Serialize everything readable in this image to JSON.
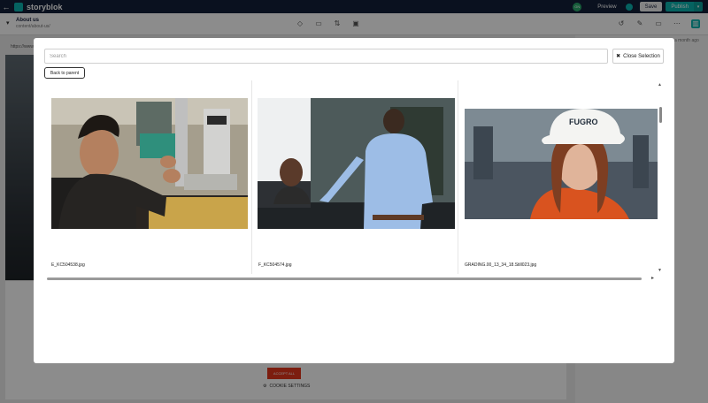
{
  "topbar": {
    "back_glyph": "←",
    "brand": "storyblok",
    "user_initials": "GN",
    "preview_label": "Preview",
    "save_label": "Save",
    "publish_label": "Publish",
    "publish_caret": "▾"
  },
  "subbar": {
    "chevron": "▾",
    "title": "About us",
    "path": "content/about-us/",
    "icons": [
      "diamond-icon",
      "comment-icon",
      "sliders-icon",
      "calendar-icon",
      "history-icon",
      "wrench-icon",
      "monitor-icon",
      "more-icon",
      "panel-icon"
    ]
  },
  "background": {
    "url_text": "https://www",
    "month_ago": "a month ago",
    "accept_label": "ACCEPT ALL",
    "cookie_label": "COOKIE SETTINGS"
  },
  "modal": {
    "search_placeholder": "Search",
    "close_label": "Close Selection",
    "close_glyph": "✖",
    "back_label": "Back to parent",
    "scroll_up": "▲",
    "scroll_down": "▼",
    "scroll_right": "▸",
    "assets": [
      {
        "filename": "E_KC504538.jpg",
        "subject": "man adjusting laboratory equipment"
      },
      {
        "filename": "F_KC504574.jpg",
        "subject": "man in blue shirt at reception desk with smiling woman"
      },
      {
        "filename": "GRADING.00_13_34_18.Still023.jpg",
        "subject": "woman wearing white hard hat",
        "hat_text": "FUGRO"
      }
    ]
  },
  "colors": {
    "accent": "#0ab3af",
    "topbar": "#13203a",
    "cookie_red": "#e2351c"
  }
}
